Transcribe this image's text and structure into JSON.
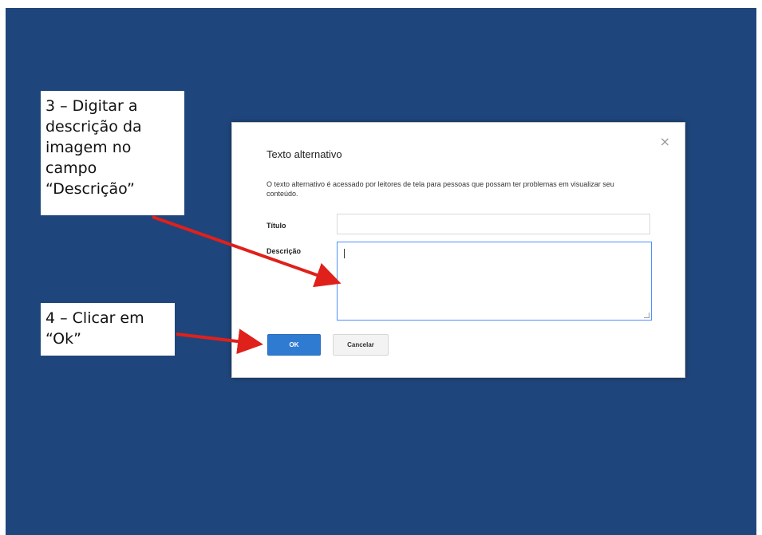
{
  "callouts": {
    "step3": {
      "lines": [
        "3 – Digitar a",
        "descrição da",
        "imagem no",
        "campo",
        "“Descrição”"
      ]
    },
    "step4": {
      "lines": [
        "4 – Clicar em",
        "“Ok”"
      ]
    }
  },
  "dialog": {
    "title": "Texto alternativo",
    "close_glyph": "×",
    "description": "O texto alternativo é acessado por leitores de tela para pessoas que possam ter problemas em visualizar seu conteúdo.",
    "fields": {
      "titulo_label": "Título",
      "titulo_value": "",
      "descricao_label": "Descrição",
      "descricao_value": ""
    },
    "buttons": {
      "ok_label": "OK",
      "cancel_label": "Cancelar"
    }
  },
  "colors": {
    "slide_background": "#1f467c",
    "arrow": "#e0201b",
    "ok_button": "#2f7bd2"
  },
  "icons": {
    "close": "close-icon",
    "arrows": "red-arrow-icon"
  }
}
